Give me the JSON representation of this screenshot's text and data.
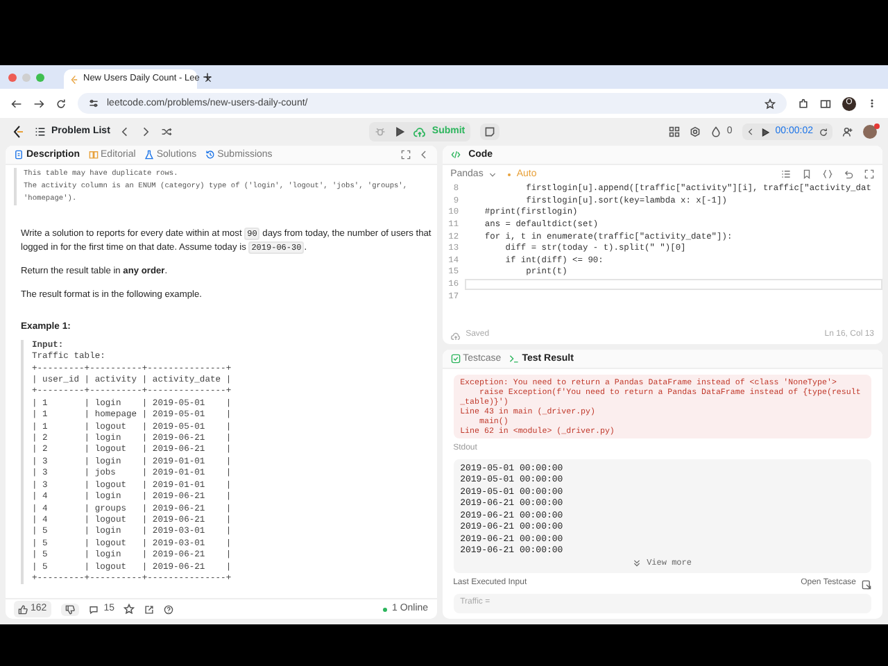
{
  "browser": {
    "tab_title": "New Users Daily Count - Lee",
    "url": "leetcode.com/problems/new-users-daily-count/",
    "profile_initial": "O"
  },
  "header": {
    "problem_list": "Problem List",
    "submit": "Submit",
    "streak": "0",
    "timer": "00:00:02"
  },
  "left_tabs": [
    {
      "label": "Description",
      "selected": true
    },
    {
      "label": "Editorial",
      "selected": false
    },
    {
      "label": "Solutions",
      "selected": false
    },
    {
      "label": "Submissions",
      "selected": false
    }
  ],
  "description": {
    "schema_lines": [
      "This table may have duplicate rows.",
      "The activity column is an ENUM (category) type of ('login', 'logout', 'jobs', 'groups',",
      "'homepage')."
    ],
    "paragraphs": [
      {
        "segments": [
          {
            "kind": "text",
            "text": "Write a solution to reports for every date within at most "
          },
          {
            "kind": "code",
            "text": "90"
          },
          {
            "kind": "text",
            "text": " days from today, the number of users that logged in for the first time on that date. Assume today is "
          },
          {
            "kind": "code",
            "text": "2019-06-30"
          },
          {
            "kind": "text",
            "text": "."
          }
        ]
      },
      {
        "segments": [
          {
            "kind": "text",
            "text": "Return the result table in **any order**."
          }
        ]
      },
      {
        "segments": [
          {
            "kind": "text",
            "text": "The result format is in the following example."
          }
        ]
      }
    ],
    "example_title": "Example 1:",
    "example_lines": [
      "**Input:**",
      "Traffic table:",
      "+---------+----------+---------------+",
      "| user_id | activity | activity_date |",
      "+---------+----------+---------------+",
      "| 1       | login    | 2019-05-01    |",
      "| 1       | homepage | 2019-05-01    |",
      "| 1       | logout   | 2019-05-01    |",
      "| 2       | login    | 2019-06-21    |",
      "| 2       | logout   | 2019-06-21    |",
      "| 3       | login    | 2019-01-01    |",
      "| 3       | jobs     | 2019-01-01    |",
      "| 3       | logout   | 2019-01-01    |",
      "| 4       | login    | 2019-06-21    |",
      "| 4       | groups   | 2019-06-21    |",
      "| 4       | logout   | 2019-06-21    |",
      "| 5       | login    | 2019-03-01    |",
      "| 5       | logout   | 2019-03-01    |",
      "| 5       | login    | 2019-06-21    |",
      "| 5       | logout   | 2019-06-21    |",
      "+---------+----------+---------------+"
    ]
  },
  "footer": {
    "likes": "162",
    "comments": "15",
    "online": "1 Online"
  },
  "code": {
    "title": "Code",
    "language": "Pandas",
    "mode": "Auto",
    "lines": [
      {
        "number": "8",
        "text": "            firstlogin[u].append([traffic[\"activity\"][i], traffic[\"activity_dat",
        "current": false
      },
      {
        "number": "9",
        "text": "            firstlogin[u].sort(key=lambda x: x[-1])",
        "current": false
      },
      {
        "number": "10",
        "text": "    #print(firstlogin)",
        "current": false
      },
      {
        "number": "11",
        "text": "    ans = defaultdict(set)",
        "current": false
      },
      {
        "number": "12",
        "text": "    for i, t in enumerate(traffic[\"activity_date\"]):",
        "current": false
      },
      {
        "number": "13",
        "text": "        diff = str(today - t).split(\" \")[0]",
        "current": false
      },
      {
        "number": "14",
        "text": "        if int(diff) <= 90:",
        "current": false
      },
      {
        "number": "15",
        "text": "            print(t)",
        "current": false
      },
      {
        "number": "16",
        "current": true
      },
      {
        "number": "17",
        "current": false
      }
    ],
    "saved": "Saved",
    "cursor": "Ln 16, Col 13"
  },
  "result_tabs": [
    {
      "label": "Testcase",
      "selected": false
    },
    {
      "label": "Test Result",
      "selected": true
    }
  ],
  "result": {
    "error_lines": [
      "Exception: You need to return a Pandas DataFrame instead of <class 'NoneType'>",
      "    raise Exception(f'You need to return a Pandas DataFrame instead of {type(result_table)}')",
      "Line 43 in main (_driver.py)",
      "    main()",
      "Line 62 in <module> (_driver.py)"
    ],
    "stdout_label": "Stdout",
    "stdout_lines": [
      "2019-05-01 00:00:00",
      "2019-05-01 00:00:00",
      "2019-05-01 00:00:00",
      "2019-06-21 00:00:00",
      "2019-06-21 00:00:00",
      "2019-06-21 00:00:00",
      "2019-06-21 00:00:00",
      "2019-06-21 00:00:00"
    ],
    "view_more": "View more",
    "last_input_label": "Last Executed Input",
    "open_testcase": "Open Testcase",
    "last_input": "Traffic ="
  }
}
